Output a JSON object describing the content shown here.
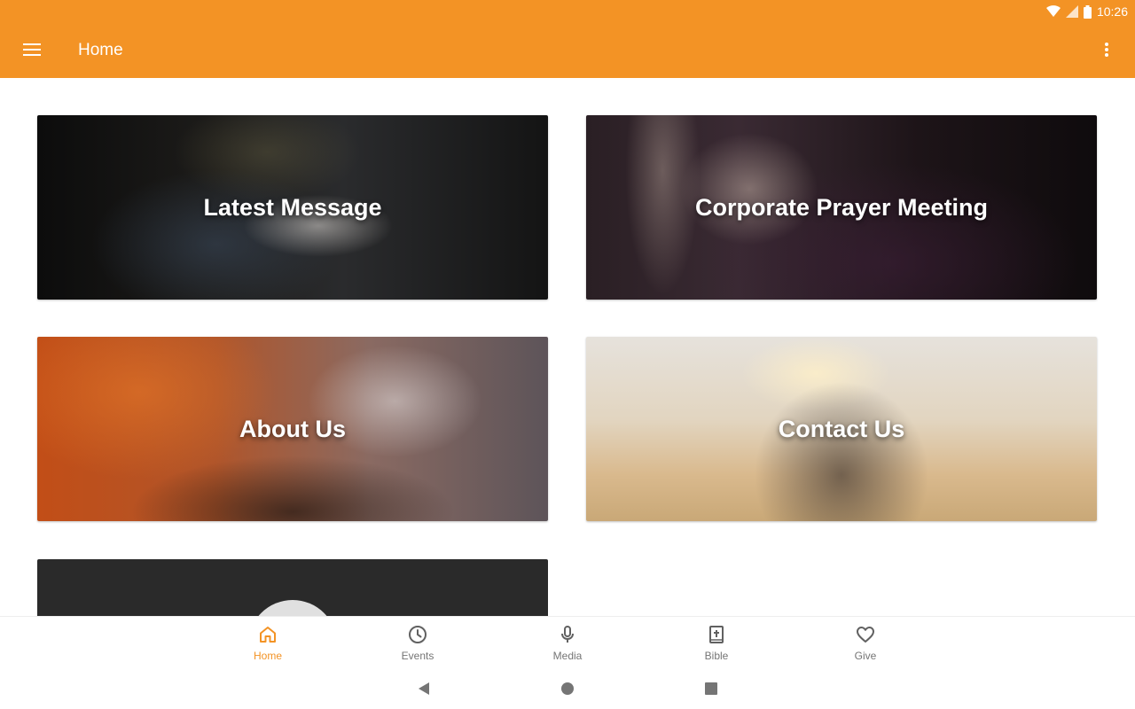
{
  "status_bar": {
    "time": "10:26",
    "icons": [
      "wifi-icon",
      "cell-signal-icon",
      "battery-icon"
    ]
  },
  "app_bar": {
    "title": "Home",
    "menu_icon": "hamburger-menu-icon",
    "overflow_icon": "more-vert-icon",
    "color": "#f39325"
  },
  "cards": [
    {
      "label": "Latest Message"
    },
    {
      "label": "Corporate Prayer Meeting"
    },
    {
      "label": "About Us"
    },
    {
      "label": "Contact Us"
    },
    {
      "label": ""
    }
  ],
  "bottom_nav": {
    "active_color": "#f39325",
    "items": [
      {
        "label": "Home",
        "icon": "home-icon",
        "active": true
      },
      {
        "label": "Events",
        "icon": "clock-icon",
        "active": false
      },
      {
        "label": "Media",
        "icon": "microphone-icon",
        "active": false
      },
      {
        "label": "Bible",
        "icon": "bible-icon",
        "active": false
      },
      {
        "label": "Give",
        "icon": "heart-icon",
        "active": false
      }
    ]
  },
  "system_nav": {
    "icons": [
      "back-icon",
      "home-circle-icon",
      "recents-icon"
    ]
  }
}
